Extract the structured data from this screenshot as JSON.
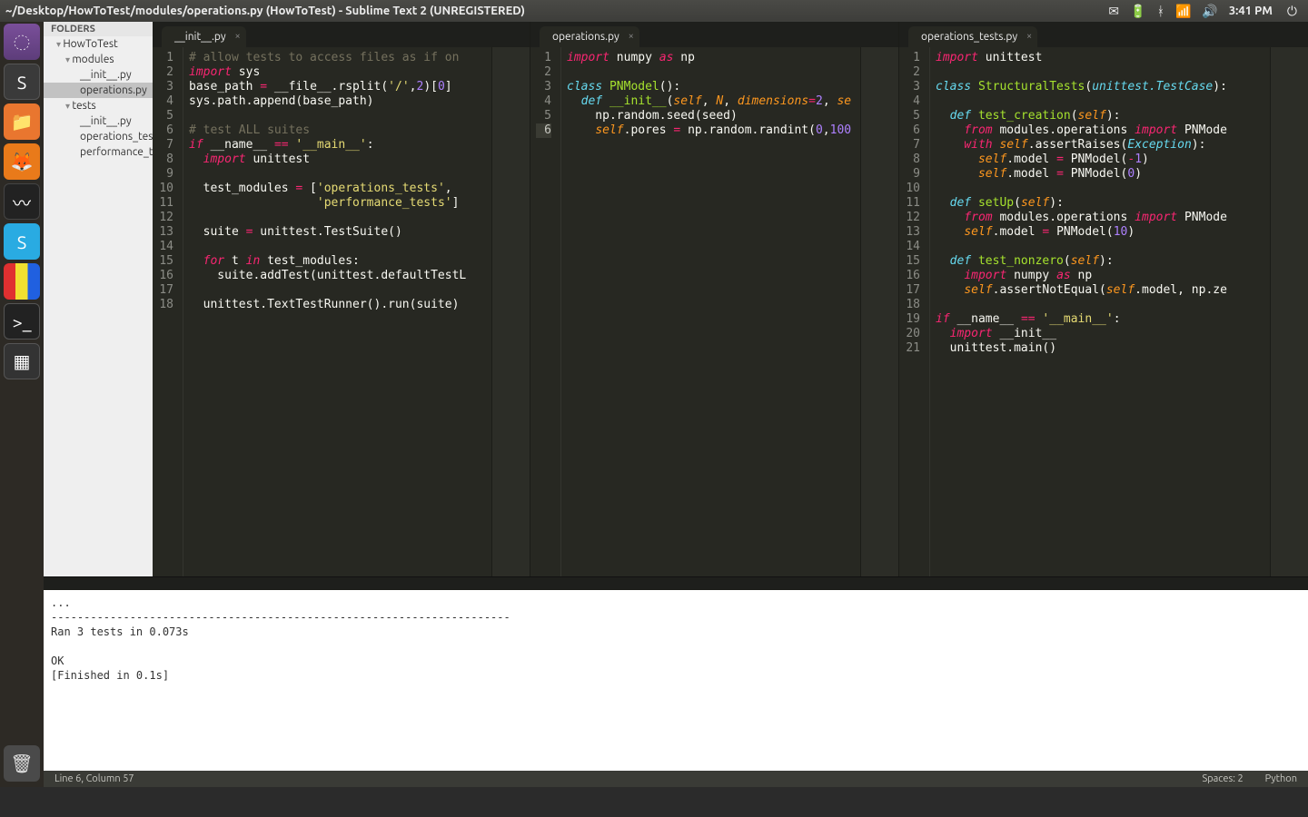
{
  "menubar": {
    "title": "~/Desktop/HowToTest/modules/operations.py (HowToTest) - Sublime Text 2 (UNREGISTERED)",
    "clock": "3:41 PM"
  },
  "launcher": {
    "items": [
      "dash",
      "sublime-text",
      "files",
      "firefox",
      "system-monitor",
      "skype",
      "color-picker",
      "terminal",
      "workspace-switcher"
    ],
    "trash": "trash"
  },
  "sidebar": {
    "header": "FOLDERS",
    "tree": [
      {
        "label": "HowToTest",
        "depth": 0,
        "folder": true
      },
      {
        "label": "modules",
        "depth": 1,
        "folder": true
      },
      {
        "label": "__init__.py",
        "depth": 2,
        "folder": false
      },
      {
        "label": "operations.py",
        "depth": 2,
        "folder": false,
        "selected": true
      },
      {
        "label": "tests",
        "depth": 1,
        "folder": true
      },
      {
        "label": "__init__.py",
        "depth": 2,
        "folder": false
      },
      {
        "label": "operations_tests.py",
        "depth": 2,
        "folder": false
      },
      {
        "label": "performance_tests.py",
        "depth": 2,
        "folder": false
      }
    ]
  },
  "panes": [
    {
      "tab": "__init__.py",
      "lines": [
        "<span class='cm'># allow tests to access files as if on</span>",
        "<span class='kw'>import</span> sys",
        "base_path <span class='op'>=</span> __file__.rsplit(<span class='str'>'/'</span>,<span class='num'>2</span>)[<span class='num'>0</span>]",
        "sys.path.append(base_path)",
        "",
        "<span class='cm'># test ALL suites</span>",
        "<span class='kw'>if</span> __name__ <span class='kw2'>==</span> <span class='str'>'__main__'</span>:",
        "  <span class='kw'>import</span> unittest",
        "",
        "  test_modules <span class='op'>=</span> [<span class='str'>'operations_tests'</span>,",
        "                  <span class='str'>'performance_tests'</span>]",
        "",
        "  suite <span class='op'>=</span> unittest.TestSuite()",
        "",
        "  <span class='kw'>for</span> t <span class='kw'>in</span> test_modules:",
        "    suite.addTest(unittest.defaultTestL",
        "",
        "  unittest.TextTestRunner().run(suite)"
      ]
    },
    {
      "tab": "operations.py",
      "selectedLine": 6,
      "lines": [
        "<span class='kw'>import</span> numpy <span class='kw'>as</span> np",
        "",
        "<span class='bi'>class</span> <span class='cls'>PNModel</span>():",
        "  <span class='bi'>def</span> <span class='fn'>__init__</span>(<span class='pm'>self</span>, <span class='pm'>N</span>, <span class='pm'>dimensions</span><span class='op'>=</span><span class='num'>2</span>, <span class='pm'>se</span>",
        "    np.random.seed(seed)",
        "    <span class='pm'>self</span>.pores <span class='op'>=</span> np.random.randint(<span class='num'>0</span>,<span class='num'>100</span>"
      ]
    },
    {
      "tab": "operations_tests.py",
      "lines": [
        "<span class='kw'>import</span> unittest",
        "",
        "<span class='bi'>class</span> <span class='cls'>StructuralTests</span>(<span class='ty'>unittest.TestCase</span>):",
        "",
        "  <span class='bi'>def</span> <span class='fn'>test_creation</span>(<span class='pm'>self</span>):",
        "    <span class='kw'>from</span> modules.operations <span class='kw'>import</span> PNMode",
        "    <span class='kw'>with</span> <span class='pm'>self</span>.assertRaises(<span class='ty'>Exception</span>):",
        "      <span class='pm'>self</span>.model <span class='op'>=</span> PNModel(<span class='op'>-</span><span class='num'>1</span>)",
        "      <span class='pm'>self</span>.model <span class='op'>=</span> PNModel(<span class='num'>0</span>)",
        "",
        "  <span class='bi'>def</span> <span class='fn'>setUp</span>(<span class='pm'>self</span>):",
        "    <span class='kw'>from</span> modules.operations <span class='kw'>import</span> PNMode",
        "    <span class='pm'>self</span>.model <span class='op'>=</span> PNModel(<span class='num'>10</span>)",
        "",
        "  <span class='bi'>def</span> <span class='fn'>test_nonzero</span>(<span class='pm'>self</span>):",
        "    <span class='kw'>import</span> numpy <span class='kw'>as</span> np",
        "    <span class='pm'>self</span>.assertNotEqual(<span class='pm'>self</span>.model, np.ze",
        "",
        "<span class='kw'>if</span> __name__ <span class='kw2'>==</span> <span class='str'>'__main__'</span>:",
        "  <span class='kw'>import</span> __init__",
        "  unittest.main()"
      ]
    }
  ],
  "output": "...\n----------------------------------------------------------------------\nRan 3 tests in 0.073s\n\nOK\n[Finished in 0.1s]",
  "statusbar": {
    "pos": "Line 6, Column 57",
    "spaces": "Spaces: 2",
    "lang": "Python"
  }
}
